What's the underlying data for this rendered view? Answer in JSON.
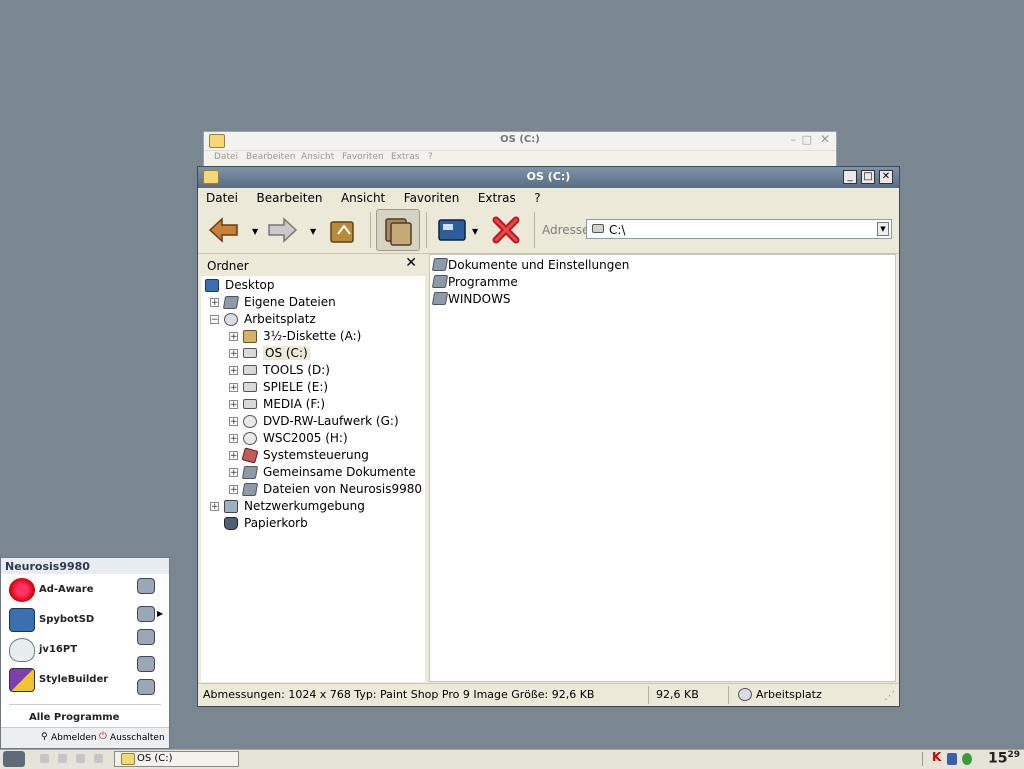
{
  "bg_window": {
    "title": "OS (C:)",
    "menu": [
      "Datei",
      "Bearbeiten",
      "Ansicht",
      "Favoriten",
      "Extras",
      "?"
    ]
  },
  "window": {
    "title": "OS (C:)",
    "menu": [
      "Datei",
      "Bearbeiten",
      "Ansicht",
      "Favoriten",
      "Extras",
      "?"
    ],
    "address_label": "Adresse",
    "address_value": "C:\\",
    "folders_header": "Ordner",
    "tree": [
      {
        "label": "Desktop",
        "icon": "desktop-icon",
        "level": 0,
        "expander": ""
      },
      {
        "label": "Eigene Dateien",
        "icon": "folder-icon",
        "level": 1,
        "expander": "+"
      },
      {
        "label": "Arbeitsplatz",
        "icon": "computer-icon",
        "level": 1,
        "expander": "−"
      },
      {
        "label": "3½-Diskette (A:)",
        "icon": "floppy-icon",
        "level": 2,
        "expander": "+"
      },
      {
        "label": "OS (C:)",
        "icon": "drive-icon",
        "level": 2,
        "expander": "+"
      },
      {
        "label": "TOOLS (D:)",
        "icon": "drive-icon",
        "level": 2,
        "expander": "+"
      },
      {
        "label": "SPIELE (E:)",
        "icon": "drive-icon",
        "level": 2,
        "expander": "+"
      },
      {
        "label": "MEDIA (F:)",
        "icon": "drive-icon",
        "level": 2,
        "expander": "+"
      },
      {
        "label": "DVD-RW-Laufwerk (G:)",
        "icon": "cd-drive-icon",
        "level": 2,
        "expander": "+"
      },
      {
        "label": "WSC2005 (H:)",
        "icon": "cd-drive-icon",
        "level": 2,
        "expander": "+"
      },
      {
        "label": "Systemsteuerung",
        "icon": "control-panel-icon",
        "level": 2,
        "expander": "+"
      },
      {
        "label": "Gemeinsame Dokumente",
        "icon": "folder-icon",
        "level": 2,
        "expander": "+"
      },
      {
        "label": "Dateien von Neurosis9980",
        "icon": "folder-icon",
        "level": 2,
        "expander": "+"
      },
      {
        "label": "Netzwerkumgebung",
        "icon": "network-icon",
        "level": 1,
        "expander": "+"
      },
      {
        "label": "Papierkorb",
        "icon": "recycle-bin-icon",
        "level": 1,
        "expander": ""
      }
    ],
    "files": [
      "Dokumente und Einstellungen",
      "Programme",
      "WINDOWS"
    ],
    "status": {
      "details": "Abmessungen: 1024 x 768 Typ: Paint Shop Pro 9 Image Größe: 92,6 KB",
      "size": "92,6 KB",
      "zone": "Arbeitsplatz"
    }
  },
  "start_menu": {
    "user": "Neurosis9980",
    "items": [
      "Ad-Aware",
      "SpybotSD",
      "jv16PT",
      "StyleBuilder"
    ],
    "all_programs": "Alle Programme",
    "logoff": "Abmelden",
    "shutdown": "Ausschalten"
  },
  "taskbar": {
    "task": "OS (C:)",
    "clock_hour": "15",
    "clock_min": "29"
  }
}
